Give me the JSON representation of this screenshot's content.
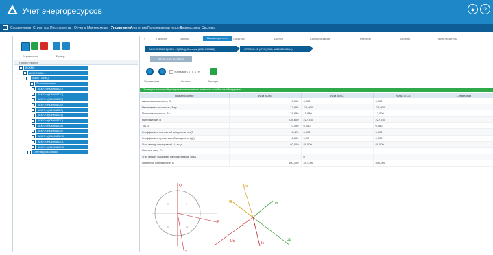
{
  "app": {
    "title": "Учет энергоресурсов"
  },
  "header": {
    "icons": [
      "notification-icon",
      "help-icon"
    ]
  },
  "menu": [
    {
      "label": "Справочники"
    },
    {
      "label": "Структура"
    },
    {
      "label": "Инструменты"
    },
    {
      "label": "Отчеты"
    },
    {
      "label": "Мнемосхемы"
    },
    {
      "label": "Управление"
    },
    {
      "label": "Аналитика"
    },
    {
      "label": "Пользователи и роли"
    },
    {
      "label": "Диагностика"
    },
    {
      "label": "Система"
    }
  ],
  "left": {
    "toolbar": {
      "manage_label": "Управление",
      "filter_label": "Фильтр"
    },
    "tree_header": "Наименование",
    "tree": [
      {
        "label": "ЖСКМО"
      },
      {
        "label": "АСКУЭ 0800-1"
      },
      {
        "label": "00800 - 0(ИКК)"
      },
      {
        "label": "Точки измерения"
      },
      {
        "label": "АСКУЭ 0(004098822/1)"
      },
      {
        "label": "АСКУЭ 0(004098822/2)"
      },
      {
        "label": "АСКУЭ 0(004098822/3)"
      },
      {
        "label": "АСКУЭ 0(004098822/4)"
      },
      {
        "label": "АСКУЭ 0(004098822/5)"
      },
      {
        "label": "АСКУЭ 0(004098822/6)"
      },
      {
        "label": "АСКУЭ 0(004098822/7)"
      },
      {
        "label": "АСКУЭ 0(004098822/8)"
      },
      {
        "label": "АСКУЭ 0(004098822/9)"
      },
      {
        "label": "АСКУЭ 0(004098822/10)"
      },
      {
        "label": "АСКУЭ 0(004098822/11)"
      },
      {
        "label": "АСКУЭ 0(004098822/12)"
      },
      {
        "label": "Счетчик (8531098684)"
      }
    ]
  },
  "tabs": [
    {
      "label": "Паспорт"
    },
    {
      "label": "Данные"
    },
    {
      "label": "Параметры сети"
    },
    {
      "label": "События"
    },
    {
      "label": "Доступ"
    },
    {
      "label": "Синхронизация"
    },
    {
      "label": "Ресурсы"
    },
    {
      "label": "Тарифы"
    },
    {
      "label": "Переключатель"
    }
  ],
  "breadcrumbs": {
    "primary": "АСКУЭ 0800-1(0800 - 0(ИКК))-Счетчик (8531098684)",
    "secondary": "СТОЗ00-12 (СТО(ИКК) №8531098684)"
  },
  "date": "08.02.2021 10:00:00",
  "actions": {
    "checkbox_label": "Учитывать КТТ, КТН",
    "manage_label": "Управление",
    "refresh_label": "Фильтр",
    "export_label": "Экспорт"
  },
  "banner": "Проверка векторной диаграммы выполнена успешно, ошибок не обнаружено",
  "table": {
    "columns": [
      "Наименование",
      "Фаза A(АВ)",
      "Фаза B(ВС)",
      "Фаза C(СА)",
      "Сумма фаз"
    ],
    "rows": [
      {
        "name": "Активная мощность, Вт",
        "a": "0,000",
        "a2": "0,000",
        "b": "0,000",
        "c": "",
        "s": ""
      },
      {
        "name": "Реактивная мощность, Вар",
        "a": "-17,986",
        "a2": "-16,000",
        "b": "-17,000",
        "c": "",
        "s": ""
      },
      {
        "name": "Полная мощность, ВА",
        "a": "15,880",
        "a2": "15,880",
        "b": "17,000",
        "c": "",
        "s": ""
      },
      {
        "name": "Напряжение, В",
        "a": "228,600",
        "a2": "227,780",
        "b": "227,780",
        "c": "",
        "s": ""
      },
      {
        "name": "Ток, А",
        "a": "0,090",
        "a2": "0,040",
        "b": "0,080",
        "c": "",
        "s": ""
      },
      {
        "name": "Коэффициент активной мощности cos(f)",
        "a": "0,470",
        "a2": "0,000",
        "b": "0,000",
        "c": "",
        "s": ""
      },
      {
        "name": "Коэффициент реактивной мощности tg(f)",
        "a": "1,600",
        "a2": "0,00",
        "b": "0,000",
        "c": "",
        "s": ""
      },
      {
        "name": "Угол между векторами U-I, град",
        "a": "80,000",
        "a2": "80,000",
        "b": "80,000",
        "c": "",
        "s": ""
      },
      {
        "name": "Частота сети, Гц",
        "a": "",
        "a2": "",
        "b": "",
        "c": "",
        "s": ""
      },
      {
        "name": "Угол между фазными напряжениями, град",
        "a": "",
        "a2": "0",
        "b": "",
        "c": "",
        "s": ""
      },
      {
        "name": "Линейное напряжение, В",
        "a": "400,100",
        "a2": "417,000",
        "b": "400,000",
        "c": "",
        "s": ""
      }
    ]
  },
  "diagram": {
    "labels": {
      "ia": "Ia",
      "ib": "Ib",
      "ic": "Ic",
      "ua": "Ua",
      "ub": "Ub",
      "uc": "Uc",
      "q": "Q",
      "p": "P",
      "s": "S"
    },
    "quadrants": [
      "I",
      "II",
      "III",
      "IV"
    ],
    "colors": {
      "ua": "#d9a21a",
      "ub": "#2a9a2e",
      "uc": "#c0282d",
      "q": "#b62c2c",
      "p": "#c0282d"
    }
  }
}
